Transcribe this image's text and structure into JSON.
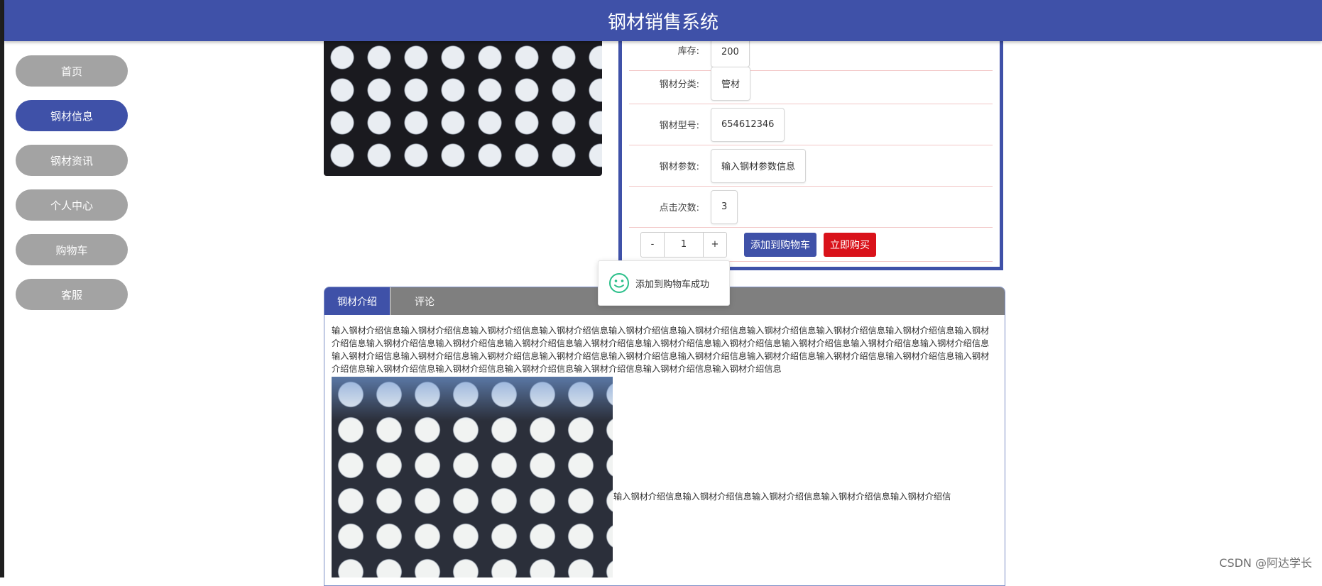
{
  "header": {
    "title": "钢材销售系统"
  },
  "sidebar": {
    "items": [
      {
        "label": "首页",
        "active": false
      },
      {
        "label": "钢材信息",
        "active": true
      },
      {
        "label": "钢材资讯",
        "active": false
      },
      {
        "label": "个人中心",
        "active": false
      },
      {
        "label": "购物车",
        "active": false
      },
      {
        "label": "客服",
        "active": false
      }
    ]
  },
  "detail": {
    "rows": [
      {
        "label": "库存:",
        "value": "200"
      },
      {
        "label": "钢材分类:",
        "value": "管材"
      },
      {
        "label": "钢材型号:",
        "value": "654612346"
      },
      {
        "label": "钢材参数:",
        "value": "输入钢材参数信息"
      },
      {
        "label": "点击次数:",
        "value": "3"
      }
    ],
    "quantity": {
      "minus": "-",
      "value": "1",
      "plus": "+"
    },
    "add_to_cart_label": "添加到购物车",
    "buy_now_label": "立即购买"
  },
  "toast": {
    "message": "添加到购物车成功"
  },
  "tabs": [
    {
      "label": "钢材介绍",
      "active": true
    },
    {
      "label": "评论",
      "active": false
    }
  ],
  "intro": {
    "text": "输入钢材介绍信息输入钢材介绍信息输入钢材介绍信息输入钢材介绍信息输入钢材介绍信息输入钢材介绍信息输入钢材介绍信息输入钢材介绍信息输入钢材介绍信息输入钢材介绍信息输入钢材介绍信息输入钢材介绍信息输入钢材介绍信息输入钢材介绍信息输入钢材介绍信息输入钢材介绍信息输入钢材介绍信息输入钢材介绍信息输入钢材介绍信息输入钢材介绍信息输入钢材介绍信息输入钢材介绍信息输入钢材介绍信息输入钢材介绍信息输入钢材介绍信息输入钢材介绍信息输入钢材介绍信息输入钢材介绍信息输入钢材介绍信息输入钢材介绍信息输入钢材介绍信息输入钢材介绍信息输入钢材介绍信息输入钢材介绍信息输入钢材介绍信息",
    "text_after_image": "输入钢材介绍信息输入钢材介绍信息输入钢材介绍信息输入钢材介绍信息输入钢材介绍信"
  },
  "watermark": "CSDN @阿达学长",
  "colors": {
    "primary": "#3f51a8",
    "danger": "#d9121a",
    "nav_inactive": "#a3a3a3",
    "tabbar": "#7f7f7f"
  }
}
